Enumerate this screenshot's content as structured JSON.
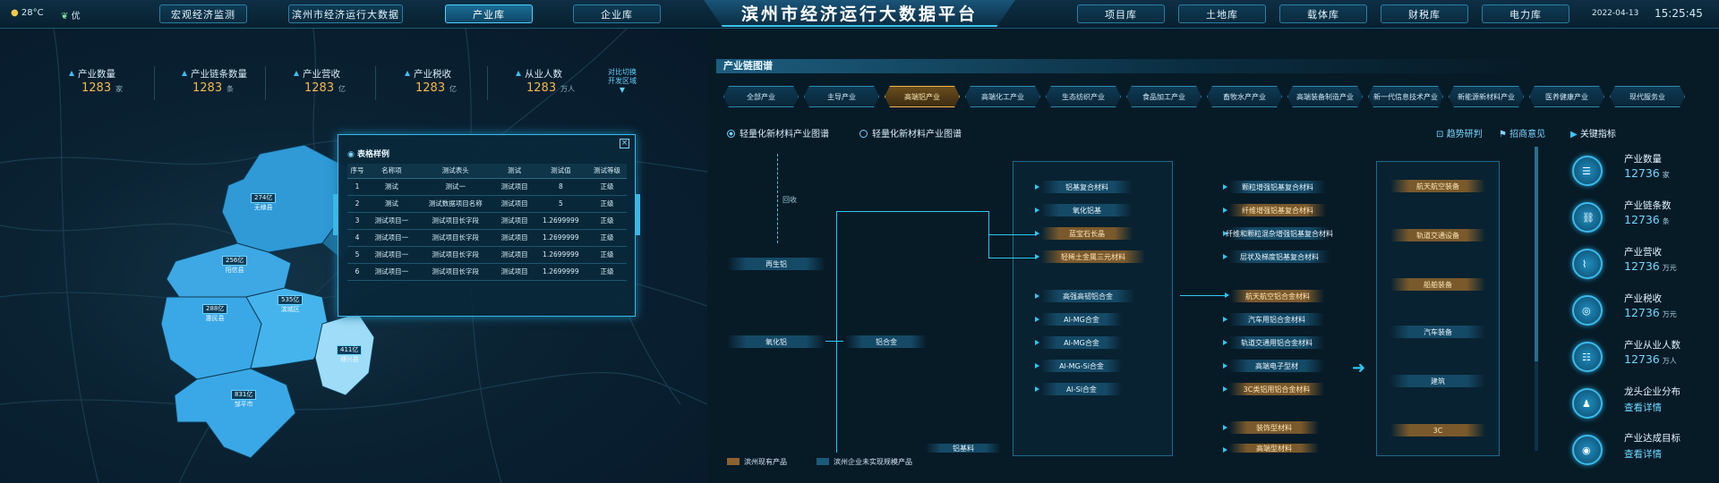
{
  "header": {
    "weather_temp": "28°C",
    "weather_quality": "优",
    "title": "滨州市经济运行大数据平台",
    "date": "2022-04-13",
    "time": "15:25:45",
    "nav_left": [
      "宏观经济监测",
      "滨州市经济运行大数据",
      "产业库",
      "企业库"
    ],
    "nav_right": [
      "项目库",
      "土地库",
      "载体库",
      "财税库",
      "电力库"
    ],
    "active_nav": "产业库"
  },
  "kpis": [
    {
      "label": "产业数量",
      "value": "1283",
      "unit": "家"
    },
    {
      "label": "产业链条数量",
      "value": "1283",
      "unit": "条"
    },
    {
      "label": "产业营收",
      "value": "1283",
      "unit": "亿"
    },
    {
      "label": "产业税收",
      "value": "1283",
      "unit": "亿"
    },
    {
      "label": "从业人数",
      "value": "1283",
      "unit": "万人"
    }
  ],
  "region_select": {
    "label": "对比切换",
    "value": "开发区域"
  },
  "map_regions": [
    {
      "value": "274亿",
      "name": "无棣县"
    },
    {
      "value": "256亿",
      "name": "阳信县"
    },
    {
      "value": "288亿",
      "name": "惠民县"
    },
    {
      "value": "535亿",
      "name": "滨城区"
    },
    {
      "value": "411亿",
      "name": "博兴县"
    },
    {
      "value": "831亿",
      "name": "邹平市"
    }
  ],
  "popup": {
    "title": "表格样例",
    "columns": [
      "序号",
      "名称项",
      "测试表头",
      "测试",
      "测试值",
      "测试等级"
    ],
    "rows": [
      [
        "1",
        "测试",
        "测试一",
        "测试项目",
        "8",
        "正级"
      ],
      [
        "2",
        "测试",
        "测试数据项目名称",
        "测试项目",
        "5",
        "正级"
      ],
      [
        "3",
        "测试项目一",
        "测试项目长字段",
        "测试项目",
        "1.2699999",
        "正级"
      ],
      [
        "4",
        "测试项目一",
        "测试项目长字段",
        "测试项目",
        "1.2699999",
        "正级"
      ],
      [
        "5",
        "测试项目一",
        "测试项目长字段",
        "测试项目",
        "1.2699999",
        "正级"
      ],
      [
        "6",
        "测试项目一",
        "测试项目长字段",
        "测试项目",
        "1.2699999",
        "正级"
      ]
    ]
  },
  "chain": {
    "section_title": "产业链图谱",
    "tabs": [
      "全部产业",
      "主导产业",
      "高端铝产业",
      "高端化工产业",
      "生态纺织产业",
      "食品加工产业",
      "畜牧水产产业",
      "高端装备制造产业",
      "新一代信息技术产业",
      "新能源新材料产业",
      "医养健康产业",
      "现代服务业"
    ],
    "active_tab": "高端铝产业",
    "radio_options": [
      "轻量化新材料产业图谱",
      "轻量化新材料产业图谱"
    ],
    "links": [
      "趋势研判",
      "招商意见"
    ],
    "key_metrics_title": "关键指标",
    "recycle_label": "回收",
    "left_nodes": [
      "再生铝",
      "氧化铝",
      "铝合金"
    ],
    "mid_nodes_top": [
      "铝基复合材料",
      "氧化铝基",
      "蓝宝石长晶",
      "轻稀土金属三元材料"
    ],
    "mid_nodes_bottom": [
      "高强高韧铝合金",
      "Al-MG合金",
      "Al-MG合金",
      "Al-MG-Si合金",
      "Al-Si合金"
    ],
    "right_nodes_top": [
      "颗粒增强铝基复合材料",
      "纤维增强铝基复合材料",
      "纤维和颗粒混杂增强铝基复合材料",
      "层状及梯度铝基复合材料"
    ],
    "right_nodes_bottom": [
      "航天航空铝合金材料",
      "汽车用铝合金材料",
      "轨道交通用铝合金材料",
      "高端电子型材",
      "3C类铝用铝合金材料",
      "装饰型材料",
      "高端型材料"
    ],
    "partial_node": "铝基料",
    "final_nodes": [
      "航天航空装备",
      "轨道交通设备",
      "船舶装备",
      "汽车装备",
      "建筑",
      "3C"
    ],
    "legend": [
      "滨州现有产品",
      "滨州企业未实现规模产品"
    ]
  },
  "metrics": [
    {
      "label": "产业数量",
      "value": "12736",
      "unit": "家",
      "icon": "document-icon"
    },
    {
      "label": "产业链条数",
      "value": "12736",
      "unit": "条",
      "icon": "link-icon"
    },
    {
      "label": "产业营收",
      "value": "12736",
      "unit": "万元",
      "icon": "chart-icon"
    },
    {
      "label": "产业税收",
      "value": "12736",
      "unit": "万元",
      "icon": "coins-icon"
    },
    {
      "label": "产业从业人数",
      "value": "12736",
      "unit": "万人",
      "icon": "people-icon"
    },
    {
      "label": "龙头企业分布",
      "link": "查看详情",
      "icon": "user-icon"
    },
    {
      "label": "产业达成目标",
      "link": "查看详情",
      "icon": "target-icon"
    }
  ],
  "colors": {
    "accent": "#3fc3f0",
    "highlight": "#f2b94e",
    "map_fill": "#3aa8e6"
  }
}
